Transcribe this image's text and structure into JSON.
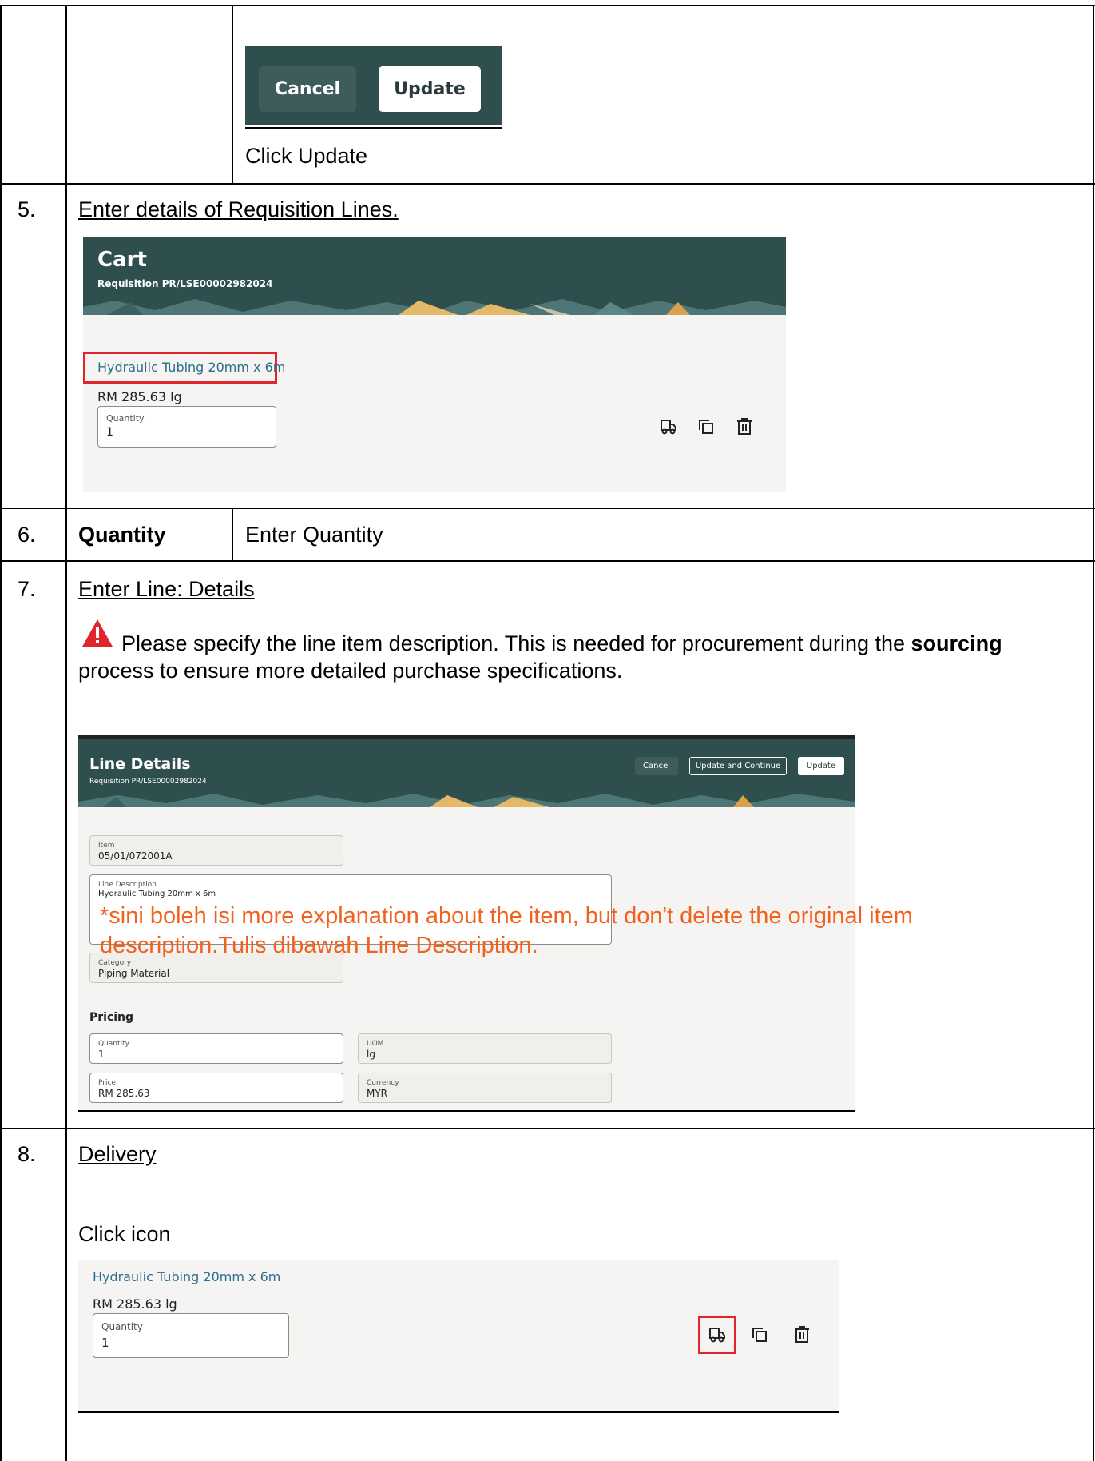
{
  "step_top": {
    "cancel_label": "Cancel",
    "update_label": "Update",
    "instruction": "Click Update"
  },
  "step5": {
    "number": "5.",
    "heading": "Enter details of Requisition Lines.",
    "cart_title": "Cart",
    "cart_subtitle": "Requisition PR/LSE00002982024",
    "item_link": "Hydraulic Tubing 20mm x 6m",
    "price_uom": "RM 285.63 lg",
    "quantity_label": "Quantity",
    "quantity_value": "1"
  },
  "step6": {
    "number": "6.",
    "field": "Quantity",
    "instruction": "Enter Quantity"
  },
  "step7": {
    "number": "7.",
    "heading": "Enter Line: Details",
    "warning_before": "Please specify the line item description. This is needed for procurement during the ",
    "warning_bold": "sourcing",
    "warning_after": "process to ensure more detailed purchase specifications.",
    "panel_title": "Line Details",
    "panel_subtitle": "Requisition PR/LSE00002982024",
    "btn_cancel": "Cancel",
    "btn_update_continue": "Update and Continue",
    "btn_update": "Update",
    "item_label": "Item",
    "item_value": "05/01/072001A",
    "line_desc_label": "Line Description",
    "line_desc_value": "Hydraulic Tubing 20mm x 6m",
    "note_line1": "*sini boleh isi more explanation about the item, but don't delete the original item",
    "note_line2": "description.Tulis dibawah Line Description.",
    "category_label": "Category",
    "category_value": "Piping Material",
    "pricing_heading": "Pricing",
    "quantity_label": "Quantity",
    "quantity_value": "1",
    "uom_label": "UOM",
    "uom_value": "lg",
    "price_label": "Price",
    "price_value": "RM 285.63",
    "currency_label": "Currency",
    "currency_value": "MYR"
  },
  "step8": {
    "number": "8.",
    "heading": "Delivery",
    "instruction": "Click icon",
    "item_link": "Hydraulic Tubing 20mm x 6m",
    "price_uom": "RM 285.63 lg",
    "quantity_label": "Quantity",
    "quantity_value": "1"
  },
  "colors": {
    "banner": "#2f4f4f",
    "link": "#2b6f8e",
    "highlight": "#e0252c",
    "note": "#f0621e",
    "warning": "#e0252c"
  },
  "icons": [
    "truck-icon",
    "duplicate-icon",
    "trash-icon",
    "warning-icon"
  ]
}
